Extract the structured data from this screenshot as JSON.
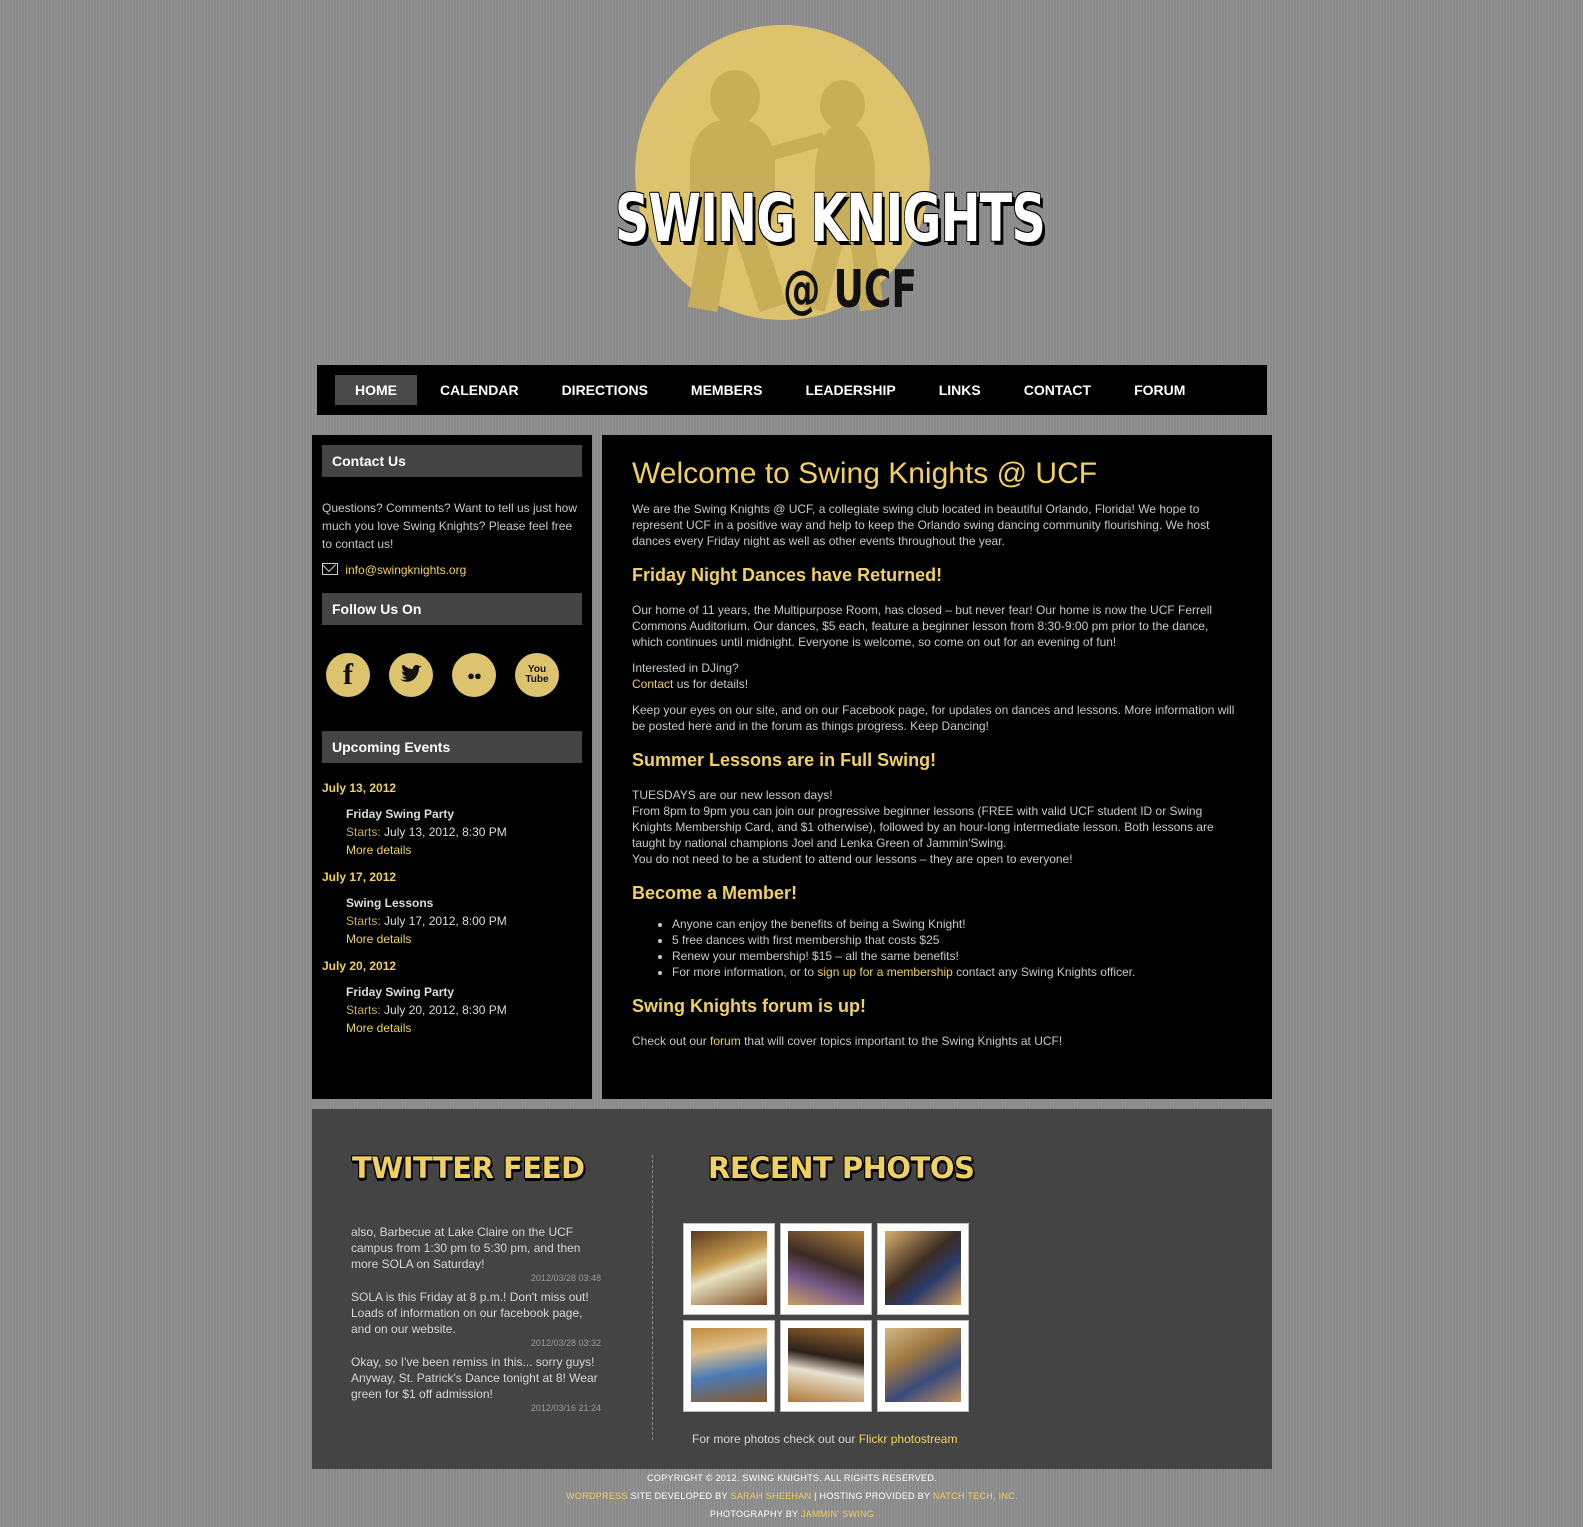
{
  "logo": {
    "title": "SWING KNIGHTS",
    "subtitle": "@ UCF"
  },
  "nav": [
    "HOME",
    "CALENDAR",
    "DIRECTIONS",
    "MEMBERS",
    "LEADERSHIP",
    "LINKS",
    "CONTACT",
    "FORUM"
  ],
  "sidebar": {
    "contact_title": "Contact Us",
    "contact_text": "Questions? Comments? Want to tell us just how much you love Swing Knights? Please feel free to contact us!",
    "email": "info@swingknights.org",
    "follow_title": "Follow Us On",
    "social": [
      {
        "icon": "facebook-icon",
        "glyph": "f"
      },
      {
        "icon": "twitter-icon",
        "glyph": "🐦"
      },
      {
        "icon": "flickr-icon",
        "glyph": "●●"
      },
      {
        "icon": "youtube-icon",
        "glyph": "You Tube"
      }
    ],
    "events_title": "Upcoming Events",
    "events": [
      {
        "date": "July 13, 2012",
        "name": "Friday Swing Party",
        "starts_label": "Starts:",
        "starts": "July 13, 2012, 8:30 PM",
        "more": "More details"
      },
      {
        "date": "July 17, 2012",
        "name": "Swing Lessons",
        "starts_label": "Starts:",
        "starts": "July 17, 2012, 8:00 PM",
        "more": "More details"
      },
      {
        "date": "July 20, 2012",
        "name": "Friday Swing Party",
        "starts_label": "Starts:",
        "starts": "July 20, 2012, 8:30 PM",
        "more": "More details"
      }
    ]
  },
  "main": {
    "title": "Welcome to Swing Knights @ UCF",
    "intro": "We are the Swing Knights @ UCF, a collegiate swing club located in beautiful Orlando, Florida! We hope to represent UCF in a positive way and help to keep the Orlando swing dancing community flourishing. We host dances every Friday night as well as other events throughout the year.",
    "h_friday": "Friday Night Dances have Returned!",
    "friday_text": "Our home of 11 years, the Multipurpose Room, has closed – but never fear! Our home is now the UCF Ferrell Commons Auditorium. Our dances, $5 each, feature a beginner lesson from 8:30-9:00 pm prior to the dance, which continues until midnight. Everyone is welcome, so come on out for an evening of fun!",
    "dj_question": "Interested in DJing?",
    "dj_link": "Contact",
    "dj_rest": " us for details!",
    "keep_eyes": "Keep your eyes on our site, and on our Facebook page, for updates on dances and lessons. More information will be posted here and in the forum as things progress. Keep Dancing!",
    "h_summer": "Summer Lessons are in Full Swing!",
    "summer_line1": "TUESDAYS are our new lesson days!",
    "summer_line2": "From 8pm to 9pm you can join our progressive beginner lessons (FREE with valid UCF student ID or Swing Knights Membership Card, and $1 otherwise), followed by an hour-long intermediate lesson. Both lessons are taught by national champions Joel and Lenka Green of Jammin'Swing.",
    "summer_line3": "You do not need to be a student to attend our lessons – they are open to everyone!",
    "h_member": "Become a Member!",
    "member_items": [
      "Anyone can enjoy the benefits of being a Swing Knight!",
      "5 free dances with first membership that costs $25",
      "Renew your membership! $15 – all the same benefits!"
    ],
    "member_last_pre": "For more information, or to ",
    "member_last_link": "sign up for a membership",
    "member_last_post": " contact any Swing Knights officer.",
    "h_forum": "Swing Knights forum is up!",
    "forum_pre": "Check out our ",
    "forum_link": "forum",
    "forum_post": " that will cover topics important to the Swing Knights at UCF!"
  },
  "footer": {
    "twitter_title": "TWITTER FEED",
    "photos_title": "RECENT PHOTOS",
    "tweets": [
      {
        "text": "also, Barbecue at Lake Claire on the UCF campus from 1:30 pm to 5:30 pm, and then more SOLA on Saturday!",
        "time": "2012/03/28 03:48"
      },
      {
        "text": "SOLA is this Friday at 8 p.m.! Don't miss out! Loads of information on our facebook page, and on our website.",
        "time": "2012/03/28 03:32"
      },
      {
        "text": "Okay, so I've been remiss in this... sorry guys! Anyway, St. Patrick's Dance tonight at 8! Wear green for $1 off admission!",
        "time": "2012/03/16 21:24"
      }
    ],
    "photo_count_note_pre": "For more photos check out our ",
    "photo_link": "Flickr photostream"
  },
  "copyright": {
    "line1": "COPYRIGHT © 2012. SWING KNIGHTS. ALL RIGHTS RESERVED.",
    "wordpress": "WORDPRESS",
    "dev_text": " SITE DEVELOPED BY ",
    "dev_name": "SARAH SHEEHAN",
    "host_text": " | HOSTING PROVIDED BY ",
    "host_name": "NATCH TECH, INC.",
    "photo_text": "PHOTOGRAPHY BY ",
    "photo_name": "JAMMIN' SWING"
  }
}
